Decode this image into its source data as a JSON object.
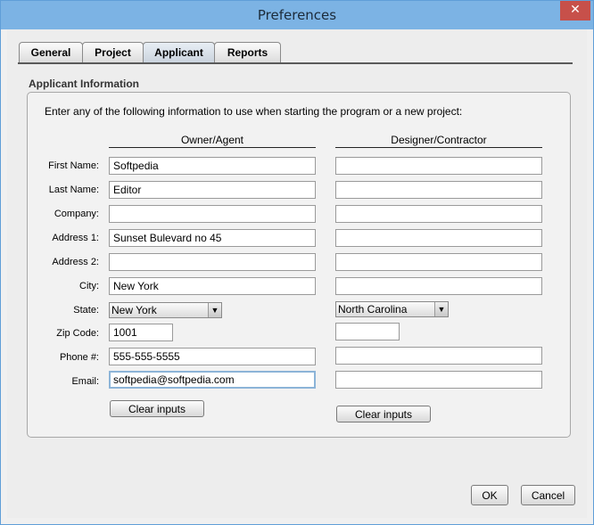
{
  "window": {
    "title": "Preferences",
    "close_glyph": "✕"
  },
  "tabs": [
    {
      "label": "General",
      "active": false
    },
    {
      "label": "Project",
      "active": false
    },
    {
      "label": "Applicant",
      "active": true
    },
    {
      "label": "Reports",
      "active": false
    }
  ],
  "panel": {
    "title": "Applicant Information",
    "intro": "Enter any of the following information to use when starting the program or a new project:"
  },
  "columns": {
    "owner": "Owner/Agent",
    "designer": "Designer/Contractor"
  },
  "labels": {
    "first_name": "First Name:",
    "last_name": "Last Name:",
    "company": "Company:",
    "address1": "Address 1:",
    "address2": "Address 2:",
    "city": "City:",
    "state": "State:",
    "zip": "Zip Code:",
    "phone": "Phone #:",
    "email": "Email:"
  },
  "owner": {
    "first_name": "Softpedia",
    "last_name": "Editor",
    "company": "",
    "address1": "Sunset Bulevard  no 45",
    "address2": "",
    "city": "New York",
    "state": "New York",
    "zip": "1001",
    "phone": "555-555-5555",
    "email": "softpedia@softpedia.com"
  },
  "designer": {
    "first_name": "",
    "last_name": "",
    "company": "",
    "address1": "",
    "address2": "",
    "city": "",
    "state": "North Carolina",
    "zip": "",
    "phone": "",
    "email": ""
  },
  "buttons": {
    "clear_owner": "Clear inputs",
    "clear_designer": "Clear inputs",
    "ok": "OK",
    "cancel": "Cancel"
  },
  "icons": {
    "dropdown": "▼"
  }
}
